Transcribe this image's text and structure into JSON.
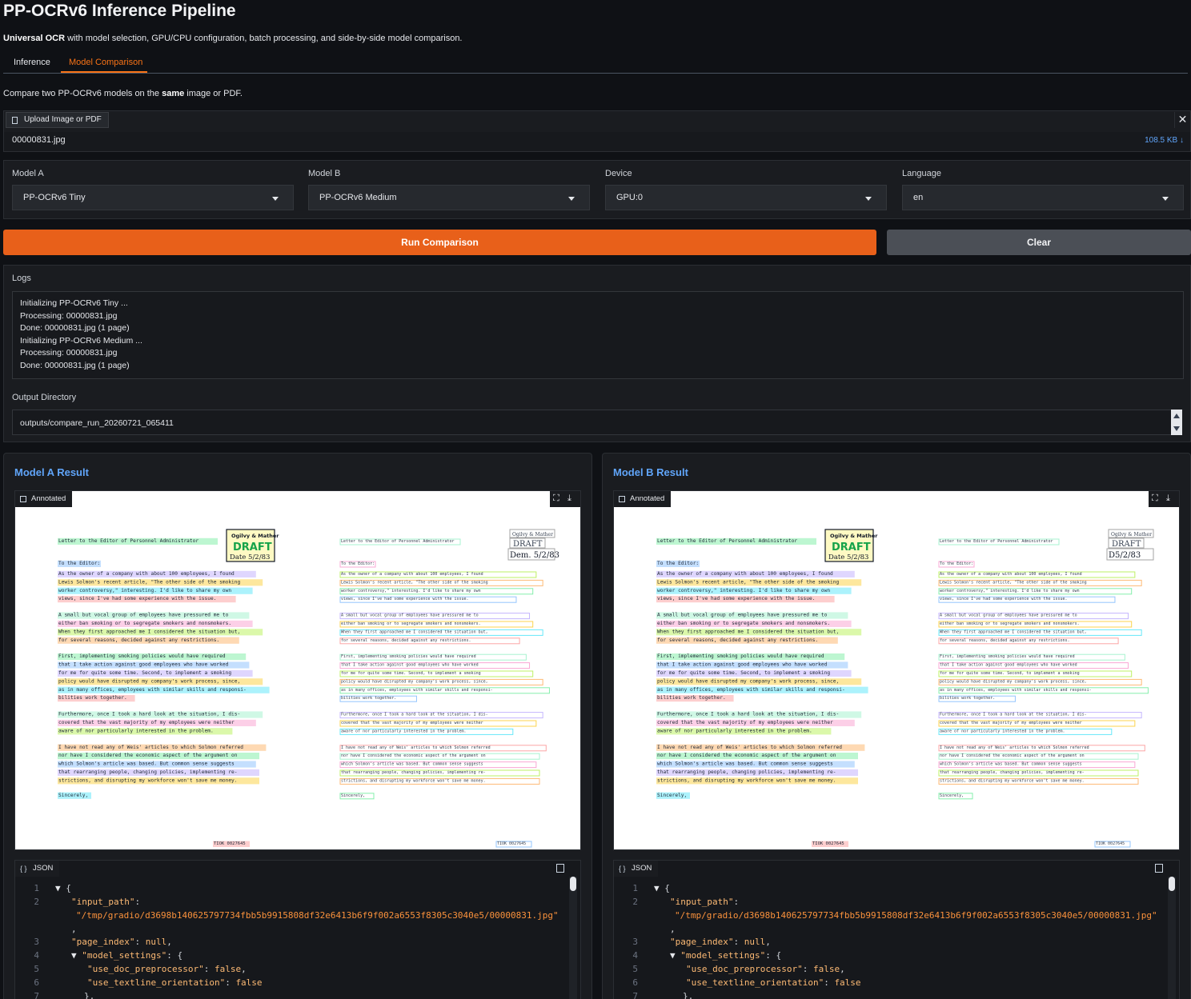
{
  "app": {
    "title": "PP-OCRv6 Inference Pipeline",
    "subtitle_bold": "Universal OCR",
    "subtitle_rest": " with model selection, GPU/CPU configuration, batch processing, and side-by-side model comparison."
  },
  "tabs": [
    {
      "label": "Inference",
      "active": false
    },
    {
      "label": "Model Comparison",
      "active": true
    }
  ],
  "intro": {
    "prefix": "Compare two PP-OCRv6 models on the ",
    "bold": "same",
    "suffix": " image or PDF."
  },
  "upload": {
    "button_label": "Upload Image or PDF",
    "close": "✕",
    "file_name": "00000831.jpg",
    "file_size": "108.5 KB ↓"
  },
  "selects": [
    {
      "label": "Model A",
      "value": "PP-OCRv6 Tiny"
    },
    {
      "label": "Model B",
      "value": "PP-OCRv6 Medium"
    },
    {
      "label": "Device",
      "value": "GPU:0"
    },
    {
      "label": "Language",
      "value": "en"
    }
  ],
  "buttons": {
    "run": "Run Comparison",
    "clear": "Clear"
  },
  "logs": {
    "label": "Logs",
    "lines": [
      "Initializing PP-OCRv6 Tiny ...",
      "Processing: 00000831.jpg",
      "Done: 00000831.jpg (1 page)",
      "Initializing PP-OCRv6 Medium ...",
      "Processing: 00000831.jpg",
      "Done: 00000831.jpg (1 page)"
    ]
  },
  "output": {
    "label": "Output Directory",
    "value": "outputs/compare_run_20260721_065411"
  },
  "results": [
    {
      "title": "Model A Result",
      "image_tag": "Annotated",
      "json_tag": "JSON",
      "stamp_date": "Dem. 5/2/83"
    },
    {
      "title": "Model B Result",
      "image_tag": "Annotated",
      "json_tag": "JSON",
      "stamp_date": "D5/2/83"
    }
  ],
  "json": {
    "input_path_key": "\"input_path\"",
    "input_path_value": "\"/tmp/gradio/d3698b140625797734fbb5b9915808df32e6413b6f9f002a6553f8305c3040e5/00000831.jpg\"",
    "page_index_key": "\"page_index\"",
    "page_index_value": "null",
    "model_settings_key": "\"model_settings\"",
    "doc_pre_key": "\"use_doc_preprocessor\"",
    "doc_pre_value": "false",
    "textline_key": "\"use_textline_orientation\"",
    "textline_value": "false"
  },
  "document": {
    "heading": "Letter to the Editor of Personnel Administrator",
    "stamp_top": "Ogilvy & Mather",
    "stamp_draft": "DRAFT",
    "stamp_date": "Date 5/2/83",
    "salutation": "To the Editor:",
    "closing": "Sincerely,",
    "footer_code": "TIOK 0027645",
    "paragraphs": [
      [
        "As the owner of a company with about 100 employees, I found",
        "Lewis Solmon's recent article, \"The other side of the smoking",
        "worker controversy,\" interesting. I'd like to share my own",
        "views, since I've had some experience with the issue."
      ],
      [
        "A small but vocal group of employees have pressured me to",
        "either ban smoking or to segregate smokers and nonsmokers.",
        "When they first approached me I considered the situation but,",
        "for several reasons, decided against any restrictions."
      ],
      [
        "First, implementing smoking policies would have required",
        "that I take action against good employees who have worked",
        "for me for quite some time. Second, to implement a smoking",
        "policy would have disrupted my company's work process, since,",
        "as in many offices, employees with similar skills and responsi-",
        "bilities work together."
      ],
      [
        "Furthermore, once I took a hard look at the situation, I dis-",
        "covered that the vast majority of my employees were neither",
        "aware of nor particularly interested in the problem."
      ],
      [
        "I have not read any of Weis' articles to which Solmon referred",
        "nor have I considered the economic aspect of the argument on",
        "which Solmon's article was based. But common sense suggests",
        "that rearranging people, changing policies, implementing re-",
        "strictions, and disrupting my workforce won't save me money."
      ]
    ]
  },
  "colors": {
    "accent": "#e8601a",
    "tab_active": "#f97316",
    "result_title": "#60a5fa"
  }
}
